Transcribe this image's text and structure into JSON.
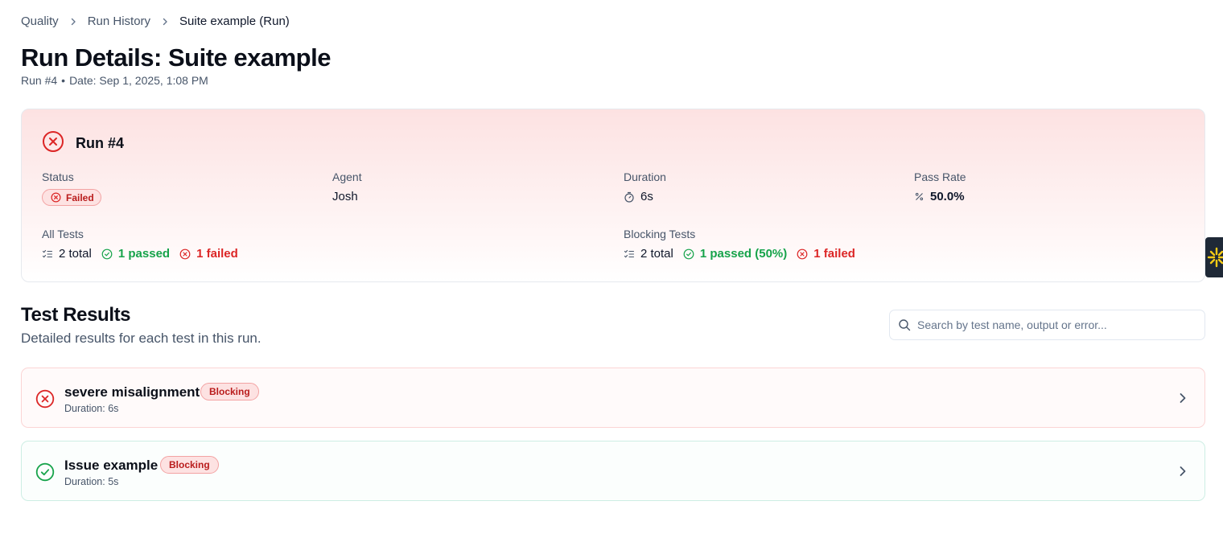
{
  "breadcrumb": {
    "items": [
      "Quality",
      "Run History"
    ],
    "current": "Suite example (Run)"
  },
  "header": {
    "title": "Run Details: Suite example",
    "run_label": "Run #4",
    "separator": "•",
    "date_label": "Date: Sep 1, 2025, 1:08 PM"
  },
  "run_card": {
    "title": "Run #4",
    "status_label": "Status",
    "status_value": "Failed",
    "agent_label": "Agent",
    "agent_value": "Josh",
    "duration_label": "Duration",
    "duration_value": "6s",
    "pass_rate_label": "Pass Rate",
    "pass_rate_value": "50.0%",
    "all_tests": {
      "label": "All Tests",
      "total": "2 total",
      "passed": "1 passed",
      "failed": "1 failed"
    },
    "blocking_tests": {
      "label": "Blocking Tests",
      "total": "2 total",
      "passed": "1 passed (50%)",
      "failed": "1 failed"
    }
  },
  "results": {
    "title": "Test Results",
    "subtitle": "Detailed results for each test in this run.",
    "search_placeholder": "Search by test name, output or error...",
    "items": [
      {
        "name": "severe misalignment",
        "badge": "Blocking",
        "duration": "Duration: 6s",
        "status": "failed"
      },
      {
        "name": "Issue example",
        "badge": "Blocking",
        "duration": "Duration: 5s",
        "status": "passed"
      }
    ]
  },
  "icons": {
    "breadcrumb_separator": "chevron-right-icon",
    "run_status": "x-circle-icon",
    "duration": "stopwatch-icon",
    "pass_rate": "percent-icon",
    "tests_total": "list-checks-icon",
    "passed": "check-circle-icon",
    "failed": "x-circle-icon",
    "search": "search-icon",
    "row_open": "chevron-right-icon"
  },
  "colors": {
    "fail": "#dc2626",
    "pass": "#16a34a",
    "badge_bg": "#fde2e2",
    "badge_text": "#b91c1c",
    "text_muted": "#475569",
    "side_tab_accent": "#facc15"
  }
}
